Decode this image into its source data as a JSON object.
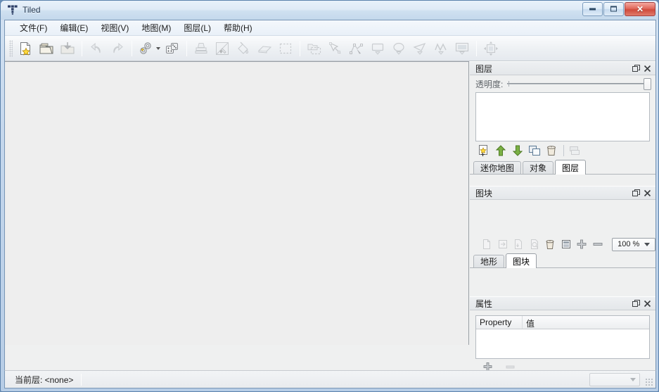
{
  "window": {
    "title": "Tiled",
    "logo_icon": "tiled-logo-icon",
    "controls": {
      "minimize_label": "minimize",
      "maximize_label": "restore",
      "close_label": "✕"
    }
  },
  "menubar": {
    "items": [
      {
        "label": "文件(F)",
        "name": "menu-file"
      },
      {
        "label": "编辑(E)",
        "name": "menu-edit"
      },
      {
        "label": "视图(V)",
        "name": "menu-view"
      },
      {
        "label": "地图(M)",
        "name": "menu-map"
      },
      {
        "label": "图层(L)",
        "name": "menu-layer"
      },
      {
        "label": "帮助(H)",
        "name": "menu-help"
      }
    ]
  },
  "toolbar": {
    "groups": [
      {
        "buttons": [
          {
            "icon": "new-map-icon",
            "enabled": true
          },
          {
            "icon": "open-folder-icon",
            "enabled": true
          },
          {
            "icon": "save-icon",
            "enabled": false
          }
        ]
      },
      {
        "buttons": [
          {
            "icon": "undo-arrow-icon",
            "enabled": false
          },
          {
            "icon": "redo-arrow-icon",
            "enabled": false
          }
        ]
      },
      {
        "buttons": [
          {
            "icon": "map-properties-gears-icon",
            "enabled": true,
            "has_dropdown": true
          },
          {
            "icon": "random-dice-icon",
            "enabled": true
          }
        ]
      },
      {
        "buttons": [
          {
            "icon": "stamp-brush-icon",
            "enabled": false
          },
          {
            "icon": "terrain-brush-icon",
            "enabled": false
          },
          {
            "icon": "fill-bucket-icon",
            "enabled": false
          },
          {
            "icon": "eraser-icon",
            "enabled": false
          },
          {
            "icon": "rectangle-select-icon",
            "enabled": false
          }
        ]
      },
      {
        "buttons": [
          {
            "icon": "magic-wand-select-icon",
            "enabled": false
          },
          {
            "icon": "select-object-icon",
            "enabled": false
          },
          {
            "icon": "edit-polygons-icon",
            "enabled": false
          },
          {
            "icon": "insert-rectangle-icon",
            "enabled": false
          },
          {
            "icon": "insert-ellipse-icon",
            "enabled": false
          },
          {
            "icon": "insert-polygon-icon",
            "enabled": false
          },
          {
            "icon": "insert-polyline-icon",
            "enabled": false
          },
          {
            "icon": "insert-tile-icon",
            "enabled": false
          }
        ]
      },
      {
        "buttons": [
          {
            "icon": "offset-layers-icon",
            "enabled": false
          }
        ]
      }
    ]
  },
  "layers_panel": {
    "title": "图层",
    "float_icon": "undock-icon",
    "close_icon": "close-icon",
    "opacity_label": "透明度:",
    "opacity_value": 100,
    "list_items": [],
    "buttons": [
      {
        "icon": "new-layer-icon",
        "enabled": true
      },
      {
        "icon": "move-layer-up-icon",
        "enabled": true
      },
      {
        "icon": "move-layer-down-icon",
        "enabled": true
      },
      {
        "icon": "duplicate-layer-icon",
        "enabled": true
      },
      {
        "icon": "delete-layer-icon",
        "enabled": true
      },
      {
        "icon": "merge-layer-down-icon",
        "enabled": false
      }
    ],
    "tabs": [
      {
        "label": "迷你地图",
        "name": "tab-minimap",
        "active": false
      },
      {
        "label": "对象",
        "name": "tab-objects",
        "active": false
      },
      {
        "label": "图层",
        "name": "tab-layers",
        "active": true
      }
    ]
  },
  "tilesets_panel": {
    "title": "图块",
    "float_icon": "undock-icon",
    "close_icon": "close-icon",
    "buttons": [
      {
        "icon": "new-tileset-icon",
        "enabled": false
      },
      {
        "icon": "embed-tileset-icon",
        "enabled": false
      },
      {
        "icon": "export-tileset-icon",
        "enabled": false
      },
      {
        "icon": "tileset-properties-icon",
        "enabled": false
      },
      {
        "icon": "remove-tileset-icon",
        "enabled": true
      },
      {
        "icon": "edit-terrain-icon",
        "enabled": true
      },
      {
        "icon": "zoom-in-icon",
        "enabled": true
      },
      {
        "icon": "zoom-out-icon",
        "enabled": true
      }
    ],
    "zoom": {
      "value": "100 %",
      "dropdown_icon": "chevron-down-icon"
    },
    "tabs": [
      {
        "label": "地形",
        "name": "tab-terrains",
        "active": false
      },
      {
        "label": "图块",
        "name": "tab-tilesets",
        "active": true
      }
    ]
  },
  "properties_panel": {
    "title": "属性",
    "float_icon": "undock-icon",
    "close_icon": "close-icon",
    "columns": [
      "Property",
      "值"
    ],
    "rows": [],
    "buttons": [
      {
        "icon": "add-property-icon",
        "enabled": true
      },
      {
        "icon": "remove-property-icon",
        "enabled": false
      }
    ]
  },
  "statusbar": {
    "current_layer_text": "当前层: <none>",
    "zoom_combo_value": "",
    "resize_grip_icon": "resize-grip-icon"
  },
  "colors": {
    "titlebar_accent": "#c4d8ec",
    "close_button": "#cf4b3c",
    "panel_bg": "#eff0f0",
    "canvas_bg": "#eeeeee",
    "frame_border": "#7996b5",
    "logo": "#2c3e66"
  }
}
